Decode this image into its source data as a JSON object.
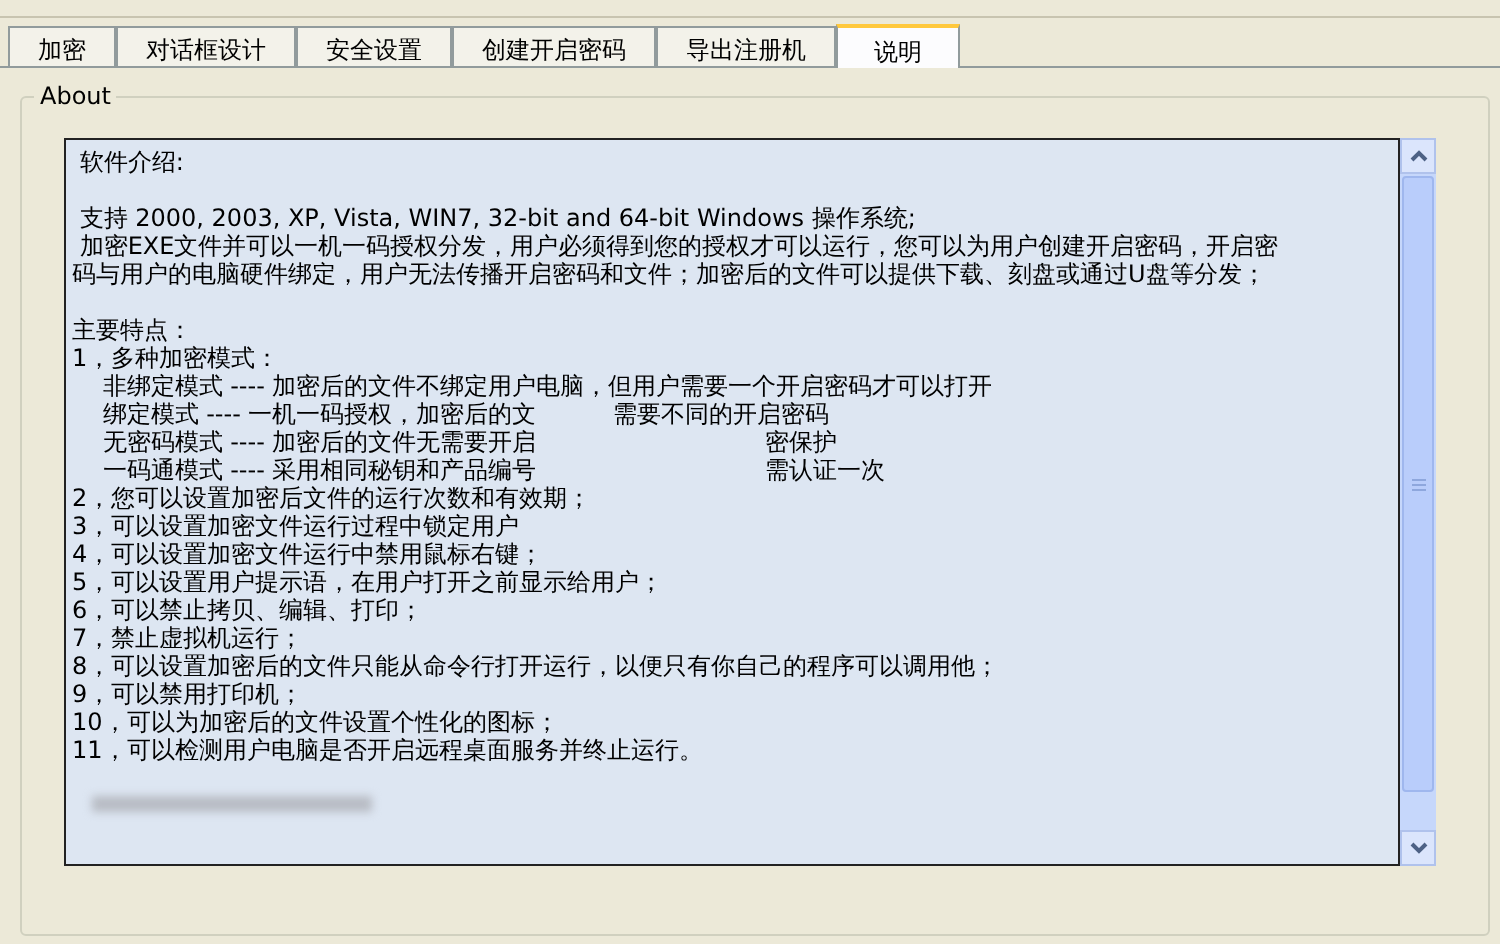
{
  "tabs": [
    {
      "label": "加密",
      "selected": false
    },
    {
      "label": "对话框设计",
      "selected": false
    },
    {
      "label": "安全设置",
      "selected": false
    },
    {
      "label": "创建开启密码",
      "selected": false
    },
    {
      "label": "导出注册机",
      "selected": false
    },
    {
      "label": "说明",
      "selected": true
    }
  ],
  "group": {
    "title": "About"
  },
  "text_area": {
    "paragraphs": [
      [
        " 软件介绍:"
      ],
      [
        " 支持 2000, 2003, XP, Vista, WIN7, 32-bit and 64-bit Windows 操作系统;",
        " 加密EXE文件并可以一机一码授权分发，用户必须得到您的授权才可以运行，您可以为用户创建开启密码，开启密",
        "码与用户的电脑硬件绑定，用户无法传播开启密码和文件；加密后的文件可以提供下载、刻盘或通过U盘等分发；"
      ],
      [
        "主要特点：",
        "1，多种加密模式：",
        "    非绑定模式 ---- 加密后的文件不绑定用户电脑，但用户需要一个开启密码才可以打开",
        "    绑定模式 ---- 一机一码授权，加密后的文          需要不同的开启密码",
        "    无密码模式 ---- 加密后的文件无需要开启                              密保护",
        "    一码通模式 ---- 采用相同秘钥和产品编号                              需认证一次",
        "2，您可以设置加密后文件的运行次数和有效期；",
        "3，可以设置加密文件运行过程中锁定用户",
        "4，可以设置加密文件运行中禁用鼠标右键；",
        "5，可以设置用户提示语，在用户打开之前显示给用户；",
        "6，可以禁止拷贝、编辑、打印；",
        "7，禁止虚拟机运行；",
        "8，可以设置加密后的文件只能从命令行打开运行，以便只有你自己的程序可以调用他；",
        "9，可以禁用打印机；",
        "10，可以为加密后的文件设置个性化的图标；",
        "11，可以检测用户电脑是否开启远程桌面服务并终止运行。"
      ]
    ]
  }
}
